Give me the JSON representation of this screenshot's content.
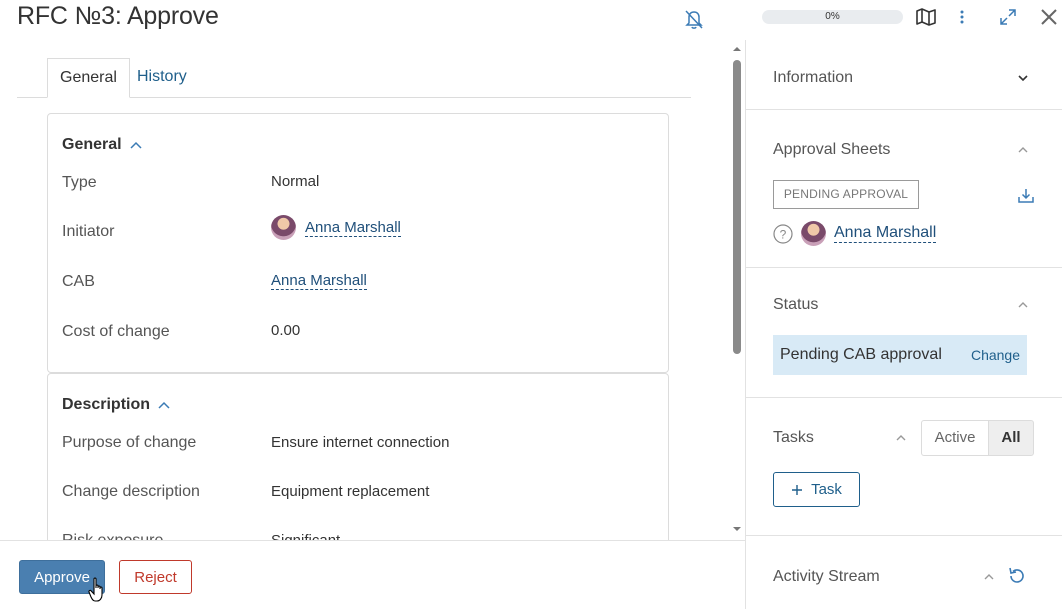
{
  "header": {
    "title": "RFC №3: Approve",
    "progress_label": "0%",
    "icons": [
      "bell-off-icon",
      "map-icon",
      "more-vertical-icon",
      "expand-icon",
      "close-icon"
    ]
  },
  "tabs": [
    {
      "label": "General",
      "active": true
    },
    {
      "label": "History",
      "active": false
    }
  ],
  "general_card": {
    "heading": "General",
    "rows": [
      {
        "label": "Type",
        "value": "Normal"
      },
      {
        "label": "Initiator",
        "value": "Anna Marshall"
      },
      {
        "label": "CAB",
        "value": "Anna Marshall"
      },
      {
        "label": "Cost of change",
        "value": "0.00"
      }
    ]
  },
  "description_card": {
    "heading": "Description",
    "rows": [
      {
        "label": "Purpose of change",
        "value": "Ensure internet connection"
      },
      {
        "label": "Change description",
        "value": "Equipment replacement"
      },
      {
        "label": "Risk exposure",
        "value": "Significant"
      }
    ]
  },
  "footer": {
    "approve_label": "Approve",
    "reject_label": "Reject"
  },
  "sidebar": {
    "information": {
      "title": "Information"
    },
    "approval_sheets": {
      "title": "Approval Sheets",
      "badge": "PENDING APPROVAL",
      "approver": "Anna Marshall"
    },
    "status": {
      "title": "Status",
      "value": "Pending CAB approval",
      "change_label": "Change"
    },
    "tasks": {
      "title": "Tasks",
      "filter_active": "Active",
      "filter_all": "All",
      "selected_filter": "All",
      "add_label": "Task"
    },
    "activity_stream": {
      "title": "Activity Stream"
    }
  },
  "colors": {
    "primary": "#4a7fb0",
    "link": "#1f5f8b",
    "reject": "#c0392b",
    "status_bg": "#d8eaf6"
  }
}
